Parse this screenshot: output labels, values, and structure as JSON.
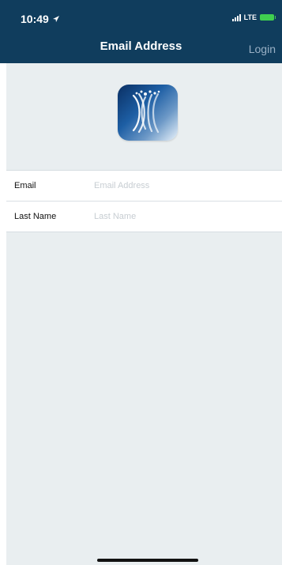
{
  "status_bar": {
    "time": "10:49",
    "carrier": "LTE"
  },
  "header": {
    "title": "Email Address",
    "login_label": "Login"
  },
  "form": {
    "email": {
      "label": "Email",
      "placeholder": "Email Address",
      "value": ""
    },
    "last_name": {
      "label": "Last Name",
      "placeholder": "Last Name",
      "value": ""
    }
  },
  "icons": {
    "location": "location-arrow-icon",
    "signal": "signal-icon",
    "battery": "battery-icon",
    "logo": "app-logo-icon"
  },
  "colors": {
    "header_bg": "#103d5d",
    "content_bg": "#e9eef0",
    "login_text": "#9ab1c6",
    "battery": "#3fcf4f"
  }
}
